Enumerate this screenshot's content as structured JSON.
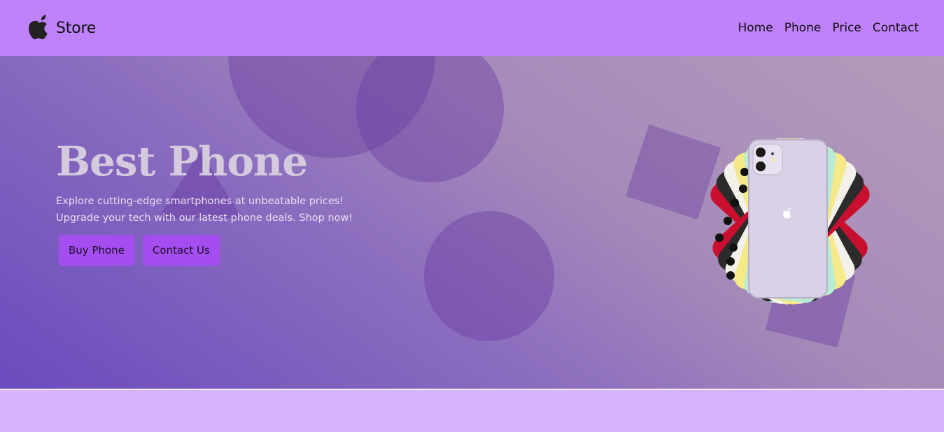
{
  "nav": {
    "brand_name": "Store",
    "links": [
      "Home",
      "Phone",
      "Price",
      "Contact"
    ]
  },
  "hero": {
    "title": "Best Phone",
    "description_lines": [
      "Explore cutting-edge smartphones at unbeatable prices!",
      "Upgrade your tech with our latest phone deals. Shop now!"
    ],
    "buttons": [
      "Buy Phone",
      "Contact Us"
    ]
  },
  "colors": {
    "navbar": "#bf82fb",
    "button": "#a54ef0",
    "footer_band": "#d6b3fb"
  },
  "icons": [
    "apple-logo-icon"
  ]
}
